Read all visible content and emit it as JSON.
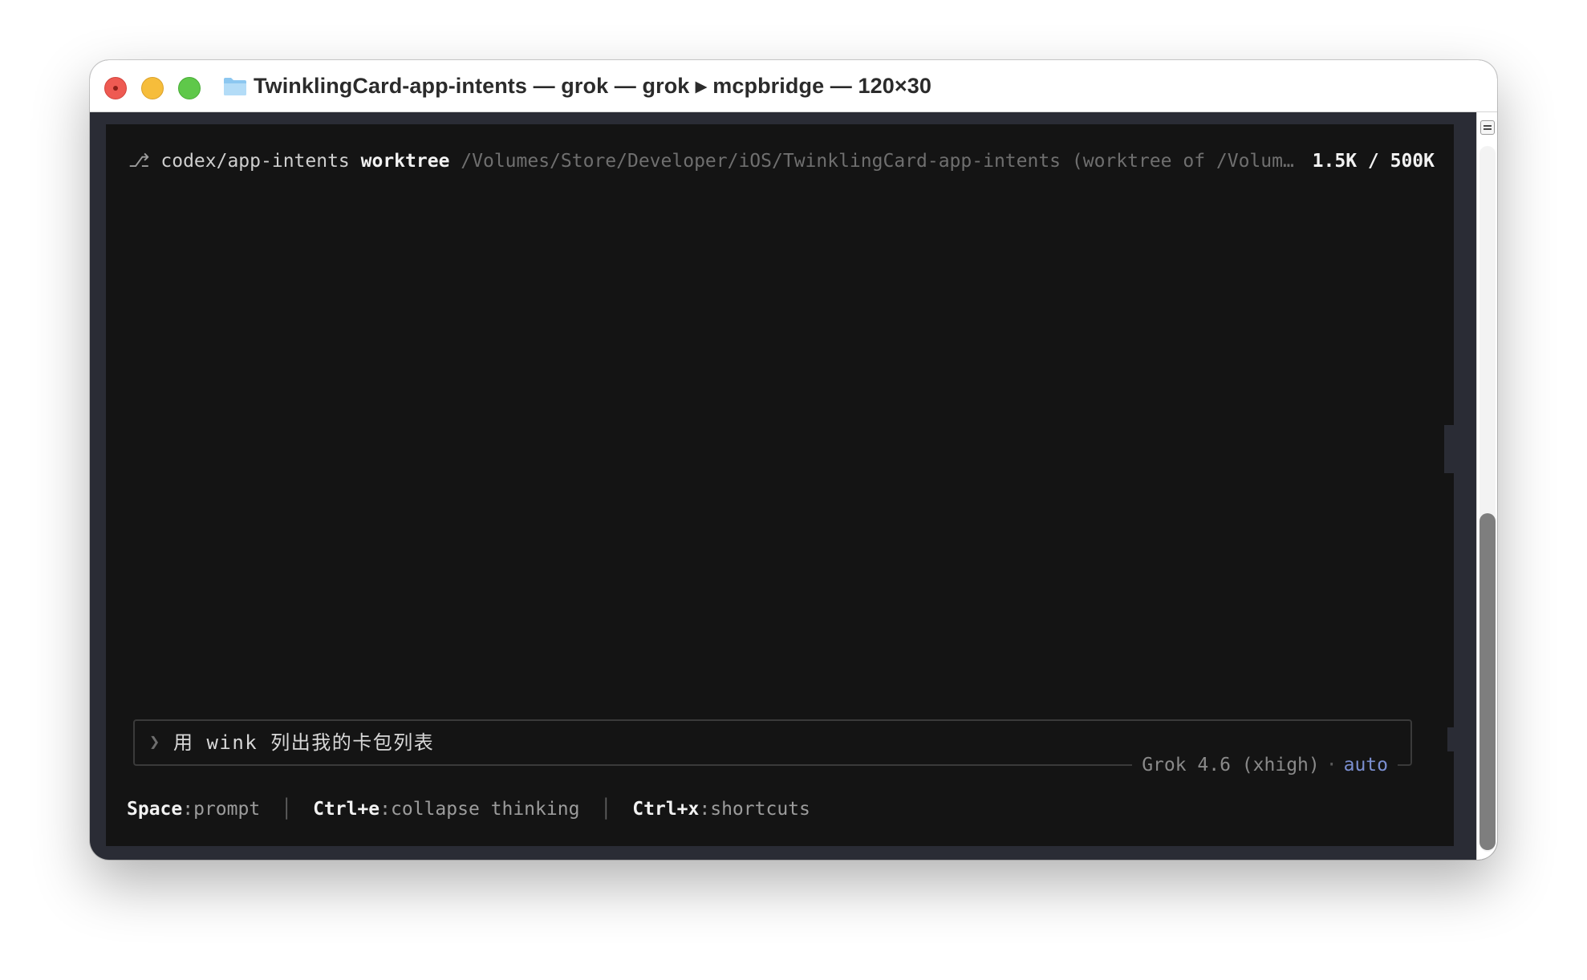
{
  "window": {
    "title": "TwinklingCard-app-intents — grok — grok ▸ mcpbridge — 120×30"
  },
  "status_bar": {
    "branch_glyph": "⎇",
    "branch": "codex/app-intents",
    "worktree_label": "worktree",
    "path": "/Volumes/Store/Developer/iOS/TwinklingCard-app-intents (worktree of /Volum…",
    "tokens": "1.5K / 500K"
  },
  "input": {
    "prompt_symbol": "❯",
    "text": "用 wink 列出我的卡包列表",
    "model": "Grok 4.6 (xhigh)",
    "separator": "·",
    "mode": "auto"
  },
  "shortcuts": [
    {
      "key": "Space",
      "action": "prompt"
    },
    {
      "key": "Ctrl+e",
      "action": "collapse thinking"
    },
    {
      "key": "Ctrl+x",
      "action": "shortcuts"
    }
  ],
  "shortcut_separator": "│",
  "icons": {
    "folder": "folder-icon",
    "close": "close-icon",
    "minimize": "minimize-icon",
    "maximize": "maximize-icon",
    "scroll_menu": "menu-icon"
  },
  "colors": {
    "terminal_bg": "#141414",
    "window_frame": "#2a2c35",
    "mode_accent": "#7b8fd1",
    "close": "#ee5a52",
    "minimize": "#f6bd3b",
    "maximize": "#5fc84a"
  }
}
